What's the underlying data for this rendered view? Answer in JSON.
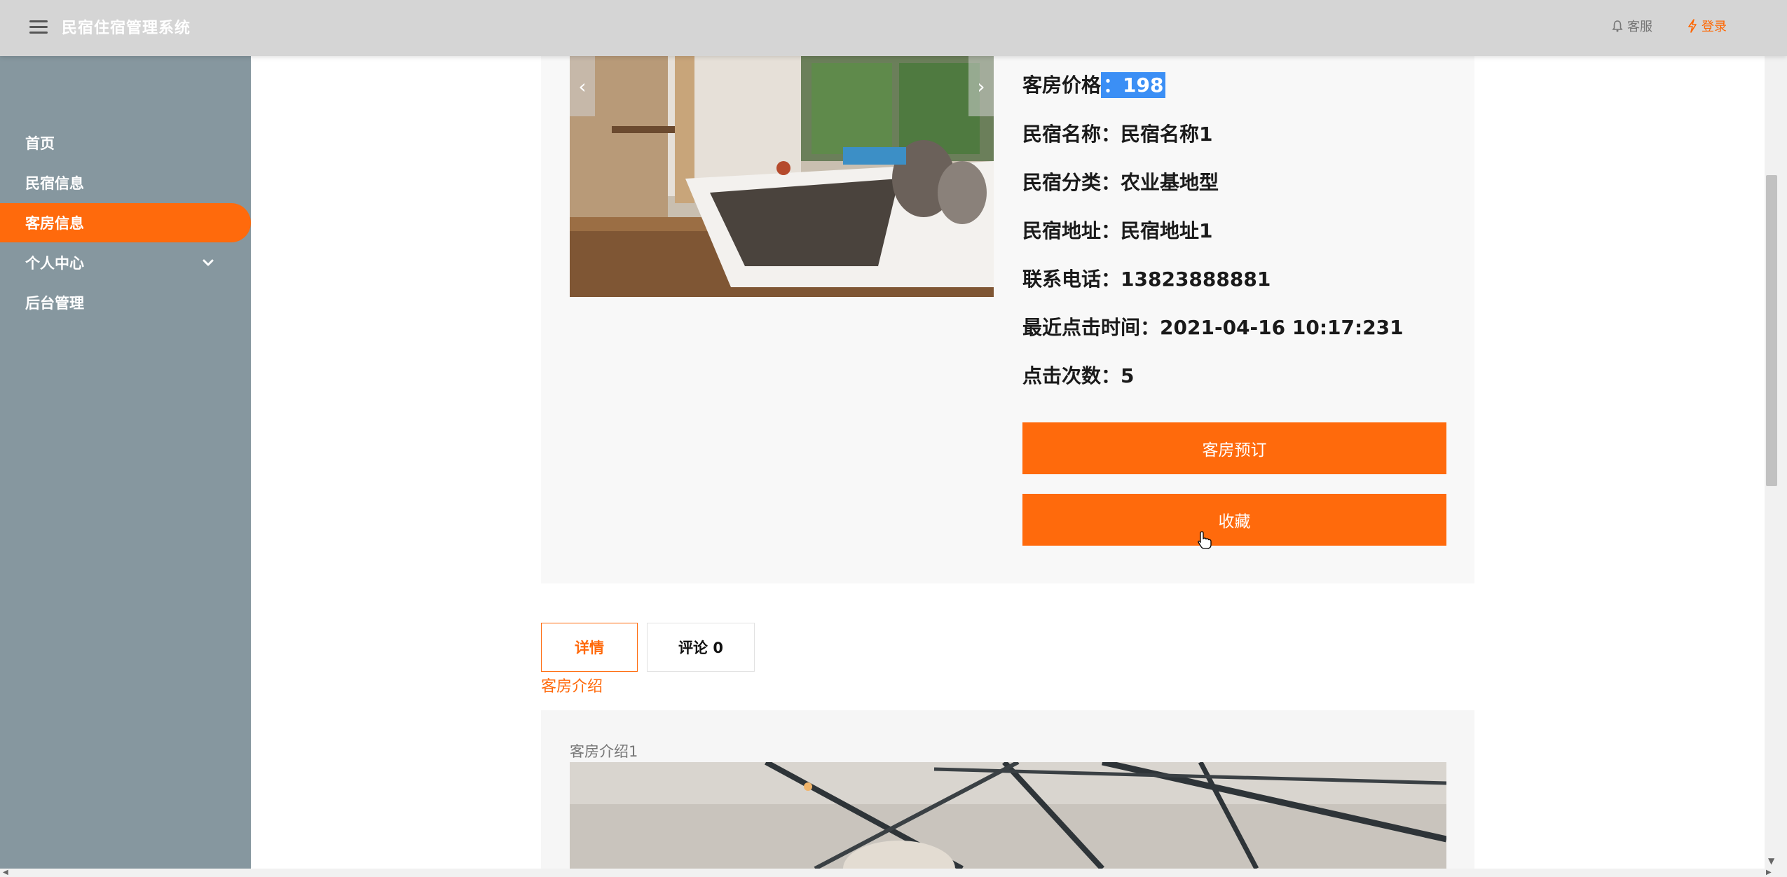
{
  "header": {
    "title": "民宿住宿管理系统",
    "service_label": "客服",
    "login_label": "登录",
    "accent_color": "#ff6600",
    "menu_icon": "hamburger-icon"
  },
  "sidebar": {
    "items": [
      {
        "label": "首页"
      },
      {
        "label": "民宿信息"
      },
      {
        "label": "客房信息",
        "active": true
      },
      {
        "label": "个人中心",
        "has_submenu": true
      },
      {
        "label": "后台管理"
      }
    ]
  },
  "room": {
    "price_label": "客房价格",
    "price_colon": "：",
    "price_value": "198",
    "name_label": "民宿名称：",
    "name_value": "民宿名称1",
    "category_label": "民宿分类：",
    "category_value": "农业基地型",
    "address_label": "民宿地址：",
    "address_value": "民宿地址1",
    "phone_label": "联系电话：",
    "phone_value": "13823888881",
    "last_click_label": "最近点击时间：",
    "last_click_value": "2021-04-16 10:17:231",
    "click_count_label": "点击次数：",
    "click_count_value": "5",
    "book_button": "客房预订",
    "favorite_button": "收藏"
  },
  "tabs": {
    "detail": "详情",
    "comment": "评论 0"
  },
  "detail": {
    "section_title": "客房介绍",
    "intro_text": "客房介绍1"
  }
}
